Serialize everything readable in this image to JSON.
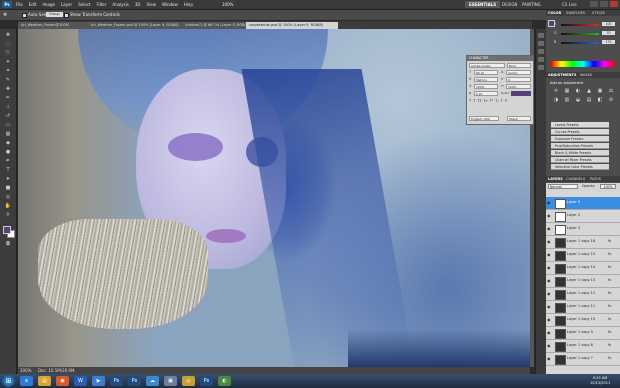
{
  "menubar": {
    "app": "Ps",
    "menus": [
      "File",
      "Edit",
      "Image",
      "Layer",
      "Select",
      "Filter",
      "Analysis",
      "3D",
      "View",
      "Window",
      "Help"
    ],
    "zoom": "100%",
    "workspaces": {
      "essentials": "ESSENTIALS",
      "design": "DESIGN",
      "painting": "PAINTING"
    },
    "cslive": "CS Live"
  },
  "options": {
    "autoselect_label": "Auto-Select:",
    "autoselect_value": "Group",
    "transform_label": "Show Transform Controls"
  },
  "tabs": [
    {
      "label": "Ari_Weather_Frozen@100%"
    },
    {
      "label": "Ari_Weather_Frozen.psd @ 100% (Layer 9, RGB/8)"
    },
    {
      "label": "Untitled-1 @ 66.7% (Layer 0, RGB/8)"
    },
    {
      "label": "corpsebride.psd @ 100% (Layer 9, RGB/8)"
    }
  ],
  "statusbar": {
    "zoom": "100%",
    "doc": "Doc: 10.5M/30.9M"
  },
  "rpanel": {
    "color_tabs": [
      "COLOR",
      "SWATCHES",
      "STYLES"
    ],
    "sliders": [
      {
        "label": "R",
        "value": "100",
        "color": "#d23030"
      },
      {
        "label": "G",
        "value": "70",
        "color": "#30b030"
      },
      {
        "label": "B",
        "value": "172",
        "color": "#3060d0"
      }
    ],
    "adj_tabs": [
      "ADJUSTMENTS",
      "MASKS"
    ],
    "adj_title": "Add an adjustment",
    "adj_icons": [
      "☀",
      "▦",
      "◐",
      "▲",
      "▣",
      "⚖",
      "◑",
      "▥",
      "◒",
      "▤",
      "◧",
      "⊘"
    ],
    "presets": [
      "Levels Presets",
      "Curves Presets",
      "Exposure Presets",
      "Hue/Saturation Presets",
      "Black & White Presets",
      "Channel Mixer Presets",
      "Selective Color Presets"
    ],
    "layer_tabs": [
      "LAYERS",
      "CHANNELS",
      "PATHS"
    ],
    "blend_mode": "Normal",
    "opacity_label": "Opacity:",
    "opacity": "100%"
  },
  "character": {
    "title": "CHARACTER",
    "font": "Adobe Arabic",
    "style": "Bold",
    "size": "60 pt",
    "leading": "(Auto)",
    "tracking": "0",
    "kerning": "Metrics",
    "vscale": "100%",
    "hscale": "100%",
    "baseline": "0 pt",
    "color_label": "Color:",
    "language": "English: USA",
    "aa": "Sharp"
  },
  "layers": [
    {
      "name": "Layer 9",
      "selected": true,
      "dark": false,
      "fx": ""
    },
    {
      "name": "Layer 2",
      "selected": false,
      "dark": false,
      "fx": ""
    },
    {
      "name": "Layer 3",
      "selected": false,
      "dark": false,
      "fx": ""
    },
    {
      "name": "Layer 1 copy 18",
      "selected": false,
      "dark": true,
      "fx": "fx"
    },
    {
      "name": "Layer 1 copy 15",
      "selected": false,
      "dark": true,
      "fx": "fx"
    },
    {
      "name": "Layer 1 copy 14",
      "selected": false,
      "dark": true,
      "fx": "fx"
    },
    {
      "name": "Layer 1 copy 13",
      "selected": false,
      "dark": true,
      "fx": "fx"
    },
    {
      "name": "Layer 1 copy 12",
      "selected": false,
      "dark": true,
      "fx": "fx"
    },
    {
      "name": "Layer 1 copy 11",
      "selected": false,
      "dark": true,
      "fx": "fx"
    },
    {
      "name": "Layer 1 copy 10",
      "selected": false,
      "dark": true,
      "fx": "fx"
    },
    {
      "name": "Layer 1 copy 9",
      "selected": false,
      "dark": true,
      "fx": "fx"
    },
    {
      "name": "Layer 1 copy 8",
      "selected": false,
      "dark": true,
      "fx": "fx"
    },
    {
      "name": "Layer 1 copy 7",
      "selected": false,
      "dark": true,
      "fx": "fx"
    }
  ],
  "taskbar": {
    "start": "⊞",
    "apps": [
      {
        "icon": "e",
        "color": "#2a7bd4"
      },
      {
        "icon": "▤",
        "color": "#d9a430"
      },
      {
        "icon": "◉",
        "color": "#d85a2a"
      },
      {
        "icon": "W",
        "color": "#2b5bb3"
      },
      {
        "icon": "▶",
        "color": "#3a7fd0"
      },
      {
        "icon": "Ps",
        "color": "#1f4c80"
      },
      {
        "icon": "Ps",
        "color": "#1f4c80"
      },
      {
        "icon": "☁",
        "color": "#3a8ad0"
      },
      {
        "icon": "▣",
        "color": "#6a7fa0"
      },
      {
        "icon": "◎",
        "color": "#c8a030"
      },
      {
        "icon": "Ps",
        "color": "#1f4c80"
      },
      {
        "icon": "◐",
        "color": "#4a8a40"
      }
    ],
    "time": "9:25 AM",
    "date": "10/15/2011"
  }
}
